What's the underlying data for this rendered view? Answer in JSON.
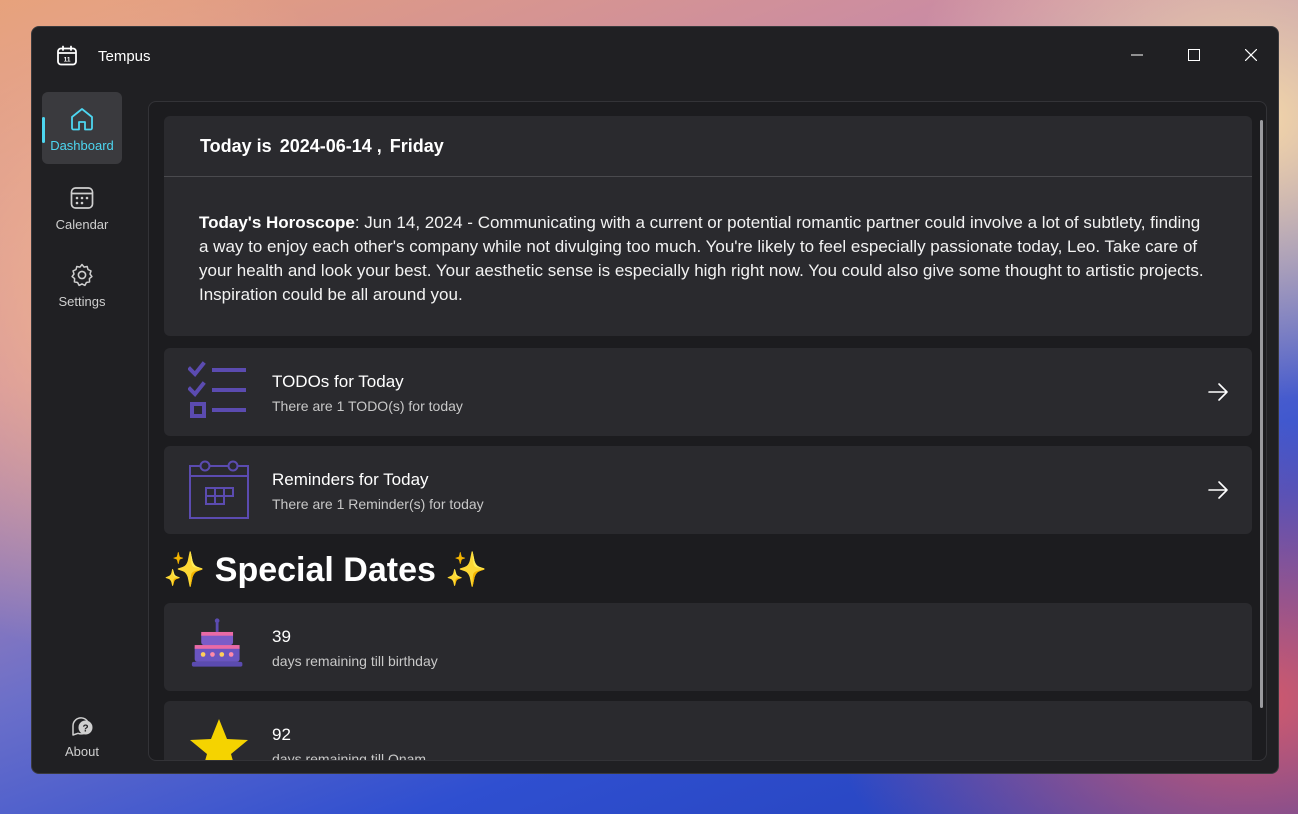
{
  "window": {
    "title": "Tempus",
    "icon": "calendar-app-icon"
  },
  "sidebar": {
    "items": [
      {
        "label": "Dashboard",
        "icon": "home-icon",
        "active": true
      },
      {
        "label": "Calendar",
        "icon": "calendar-icon",
        "active": false
      },
      {
        "label": "Settings",
        "icon": "gear-icon",
        "active": false
      }
    ],
    "footer": {
      "label": "About",
      "icon": "help-chat-icon"
    }
  },
  "today": {
    "prefix": "Today is",
    "date": "2024-06-14 ,",
    "weekday": "Friday"
  },
  "horoscope": {
    "label": "Today's Horoscope",
    "text": ": Jun 14, 2024 - Communicating with a current or potential romantic partner could involve a lot of subtlety, finding a way to enjoy each other's company while not divulging too much. You're likely to feel especially passionate today, Leo. Take care of your health and look your best. Your aesthetic sense is especially high right now. You could also give some thought to artistic projects. Inspiration could be all around you."
  },
  "todos": {
    "title": "TODOs for Today",
    "subtitle": "There are 1 TODO(s) for today",
    "icon": "checklist-icon"
  },
  "reminders": {
    "title": "Reminders for Today",
    "subtitle": "There are 1 Reminder(s) for today",
    "icon": "calendar-grid-icon"
  },
  "special": {
    "heading": "Special Dates",
    "sparkle": "✨",
    "items": [
      {
        "count": "39",
        "label": "days remaining till birthday",
        "icon": "birthday-cake-icon"
      },
      {
        "count": "92",
        "label": "days remaining till Onam",
        "icon": "star-icon"
      }
    ]
  },
  "colors": {
    "accent": "#4dd6f0",
    "icon_purple": "#5b4bb0",
    "star": "#f5d300"
  }
}
